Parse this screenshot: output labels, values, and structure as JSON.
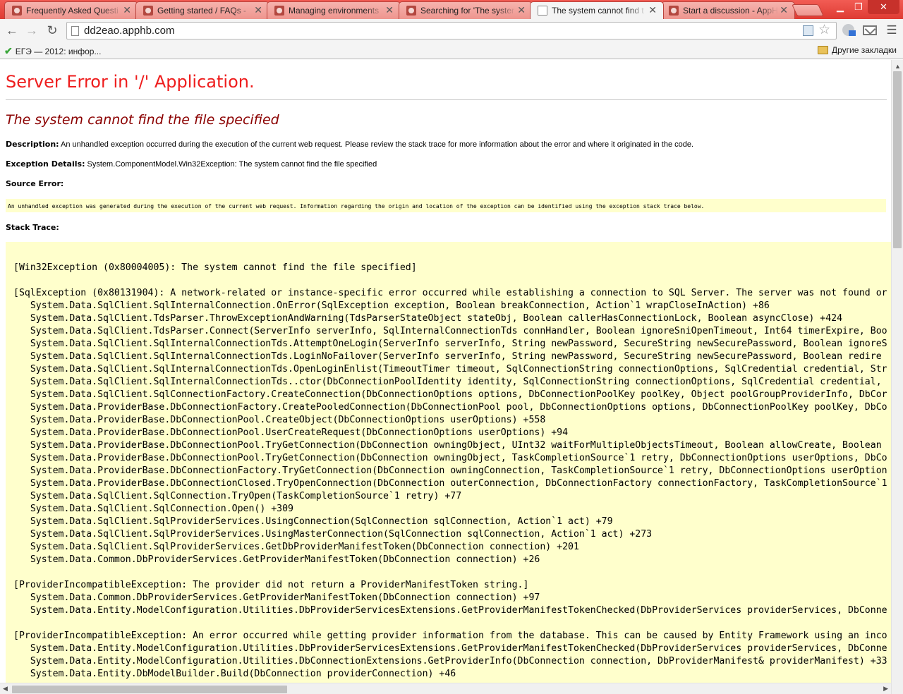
{
  "tabs": [
    {
      "title": "Frequently Asked Questi",
      "active": false
    },
    {
      "title": "Getting started / FAQs - ",
      "active": false
    },
    {
      "title": "Managing environments",
      "active": false
    },
    {
      "title": "Searching for 'The syster",
      "active": false
    },
    {
      "title": "The system cannot find t",
      "active": true
    },
    {
      "title": "Start a discussion - AppH",
      "active": false
    }
  ],
  "toolbar": {
    "url": "dd2eao.apphb.com"
  },
  "bookmarks": {
    "item1": "ЕГЭ — 2012: инфор...",
    "other": "Другие закладки"
  },
  "page": {
    "heading": "Server Error in '/' Application.",
    "error_title": "The system cannot find the file specified",
    "description_label": "Description:",
    "description_text": "An unhandled exception occurred during the execution of the current web request. Please review the stack trace for more information about the error and where it originated in the code.",
    "exception_label": "Exception Details:",
    "exception_text": "System.ComponentModel.Win32Exception: The system cannot find the file specified",
    "source_error_label": "Source Error:",
    "source_error_text": "An unhandled exception was generated during the execution of the current web request. Information regarding the origin and location of the exception can be identified using the exception stack trace below.",
    "stack_trace_label": "Stack Trace:",
    "stack_trace": "[Win32Exception (0x80004005): The system cannot find the file specified]\n\n[SqlException (0x80131904): A network-related or instance-specific error occurred while establishing a connection to SQL Server. The server was not found or\n   System.Data.SqlClient.SqlInternalConnection.OnError(SqlException exception, Boolean breakConnection, Action`1 wrapCloseInAction) +86\n   System.Data.SqlClient.TdsParser.ThrowExceptionAndWarning(TdsParserStateObject stateObj, Boolean callerHasConnectionLock, Boolean asyncClose) +424\n   System.Data.SqlClient.TdsParser.Connect(ServerInfo serverInfo, SqlInternalConnectionTds connHandler, Boolean ignoreSniOpenTimeout, Int64 timerExpire, Boo\n   System.Data.SqlClient.SqlInternalConnectionTds.AttemptOneLogin(ServerInfo serverInfo, String newPassword, SecureString newSecurePassword, Boolean ignoreS\n   System.Data.SqlClient.SqlInternalConnectionTds.LoginNoFailover(ServerInfo serverInfo, String newPassword, SecureString newSecurePassword, Boolean redire\n   System.Data.SqlClient.SqlInternalConnectionTds.OpenLoginEnlist(TimeoutTimer timeout, SqlConnectionString connectionOptions, SqlCredential credential, Str\n   System.Data.SqlClient.SqlInternalConnectionTds..ctor(DbConnectionPoolIdentity identity, SqlConnectionString connectionOptions, SqlCredential credential,\n   System.Data.SqlClient.SqlConnectionFactory.CreateConnection(DbConnectionOptions options, DbConnectionPoolKey poolKey, Object poolGroupProviderInfo, DbCor\n   System.Data.ProviderBase.DbConnectionFactory.CreatePooledConnection(DbConnectionPool pool, DbConnectionOptions options, DbConnectionPoolKey poolKey, DbCo\n   System.Data.ProviderBase.DbConnectionPool.CreateObject(DbConnectionOptions userOptions) +558\n   System.Data.ProviderBase.DbConnectionPool.UserCreateRequest(DbConnectionOptions userOptions) +94\n   System.Data.ProviderBase.DbConnectionPool.TryGetConnection(DbConnection owningObject, UInt32 waitForMultipleObjectsTimeout, Boolean allowCreate, Boolean\n   System.Data.ProviderBase.DbConnectionPool.TryGetConnection(DbConnection owningObject, TaskCompletionSource`1 retry, DbConnectionOptions userOptions, DbCo\n   System.Data.ProviderBase.DbConnectionFactory.TryGetConnection(DbConnection owningConnection, TaskCompletionSource`1 retry, DbConnectionOptions userOption\n   System.Data.ProviderBase.DbConnectionClosed.TryOpenConnection(DbConnection outerConnection, DbConnectionFactory connectionFactory, TaskCompletionSource`1\n   System.Data.SqlClient.SqlConnection.TryOpen(TaskCompletionSource`1 retry) +77\n   System.Data.SqlClient.SqlConnection.Open() +309\n   System.Data.SqlClient.SqlProviderServices.UsingConnection(SqlConnection sqlConnection, Action`1 act) +79\n   System.Data.SqlClient.SqlProviderServices.UsingMasterConnection(SqlConnection sqlConnection, Action`1 act) +273\n   System.Data.SqlClient.SqlProviderServices.GetDbProviderManifestToken(DbConnection connection) +201\n   System.Data.Common.DbProviderServices.GetProviderManifestToken(DbConnection connection) +26\n\n[ProviderIncompatibleException: The provider did not return a ProviderManifestToken string.]\n   System.Data.Common.DbProviderServices.GetProviderManifestToken(DbConnection connection) +97\n   System.Data.Entity.ModelConfiguration.Utilities.DbProviderServicesExtensions.GetProviderManifestTokenChecked(DbProviderServices providerServices, DbConne\n\n[ProviderIncompatibleException: An error occurred while getting provider information from the database. This can be caused by Entity Framework using an inco\n   System.Data.Entity.ModelConfiguration.Utilities.DbProviderServicesExtensions.GetProviderManifestTokenChecked(DbProviderServices providerServices, DbConne\n   System.Data.Entity.ModelConfiguration.Utilities.DbConnectionExtensions.GetProviderInfo(DbConnection connection, DbProviderManifest& providerManifest) +33\n   System.Data.Entity.DbModelBuilder.Build(DbConnection providerConnection) +46"
  }
}
